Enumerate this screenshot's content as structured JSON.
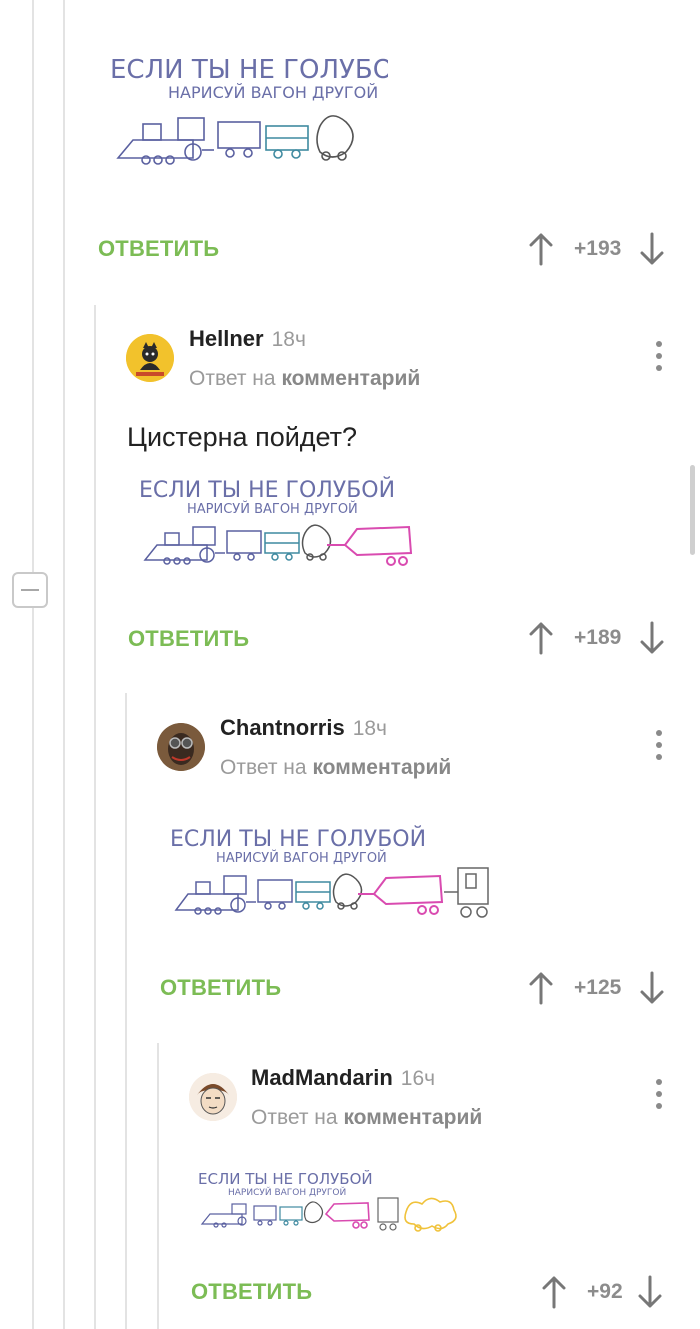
{
  "thread": {
    "collapse_symbol": "−"
  },
  "comments": [
    {
      "id": "c0",
      "reply_label": "ОТВЕТИТЬ",
      "rating": "+193",
      "image": {
        "line1": "ЕСЛИ ТЫ НЕ ГОЛУБОЙ",
        "line2": "НАРИСУЙ ВАГОН ДРУГОЙ",
        "cars": [
          "locomotive",
          "wagon-blue",
          "wagon-teal",
          "wagon-outline"
        ]
      }
    },
    {
      "id": "c1",
      "author": "Hellner",
      "time": "18ч",
      "reply_prefix": "Ответ на",
      "reply_target": "комментарий",
      "text": "Цистерна пойдет?",
      "reply_label": "ОТВЕТИТЬ",
      "rating": "+189",
      "image": {
        "line1": "ЕСЛИ ТЫ НЕ ГОЛУБОЙ",
        "line2": "НАРИСУЙ ВАГОН ДРУГОЙ",
        "cars": [
          "locomotive",
          "wagon-blue",
          "wagon-teal",
          "wagon-outline",
          "tank-pink"
        ]
      }
    },
    {
      "id": "c2",
      "author": "Chantnorris",
      "time": "18ч",
      "reply_prefix": "Ответ на",
      "reply_target": "комментарий",
      "reply_label": "ОТВЕТИТЬ",
      "rating": "+125",
      "image": {
        "line1": "ЕСЛИ ТЫ НЕ ГОЛУБОЙ",
        "line2": "НАРИСУЙ ВАГОН ДРУГОЙ",
        "cars": [
          "locomotive",
          "wagon-blue",
          "wagon-teal",
          "wagon-outline",
          "tank-pink",
          "cab-gray"
        ]
      }
    },
    {
      "id": "c3",
      "author": "MadMandarin",
      "time": "16ч",
      "reply_prefix": "Ответ на",
      "reply_target": "комментарий",
      "reply_label": "ОТВЕТИТЬ",
      "rating": "+92",
      "image": {
        "line1": "ЕСЛИ ТЫ НЕ ГОЛУБОЙ",
        "line2": "НАРИСУЙ ВАГОН ДРУГОЙ",
        "cars": [
          "locomotive",
          "wagon-blue",
          "wagon-teal",
          "wagon-outline",
          "tank-pink",
          "cab-gray",
          "cloud-yellow"
        ]
      }
    }
  ],
  "icons": {
    "upvote": "arrow-up-icon",
    "downvote": "arrow-down-icon",
    "more": "more-vertical-icon",
    "collapse": "minus-icon"
  },
  "colors": {
    "accent_green": "#7cbc55",
    "thread_line": "#e3e3e3",
    "muted_text": "#9a9a9a",
    "rating_text": "#8c8c8c"
  }
}
